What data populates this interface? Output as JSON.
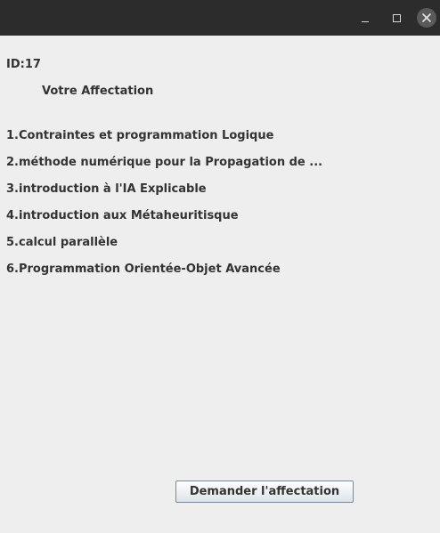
{
  "window": {
    "controls": {
      "minimize_icon": "minimize-icon",
      "maximize_icon": "maximize-icon",
      "close_icon": "close-icon"
    }
  },
  "main": {
    "id_label": "ID:17",
    "heading": "Votre Affectation",
    "courses": [
      "1.Contraintes et programmation Logique",
      "2.méthode numérique pour la Propagation de ...",
      "3.introduction à l'IA Explicable",
      "4.introduction aux Métaheuritisque",
      "5.calcul parallèle",
      "6.Programmation Orientée-Objet Avancée"
    ],
    "request_button": "Demander l'affectation"
  }
}
